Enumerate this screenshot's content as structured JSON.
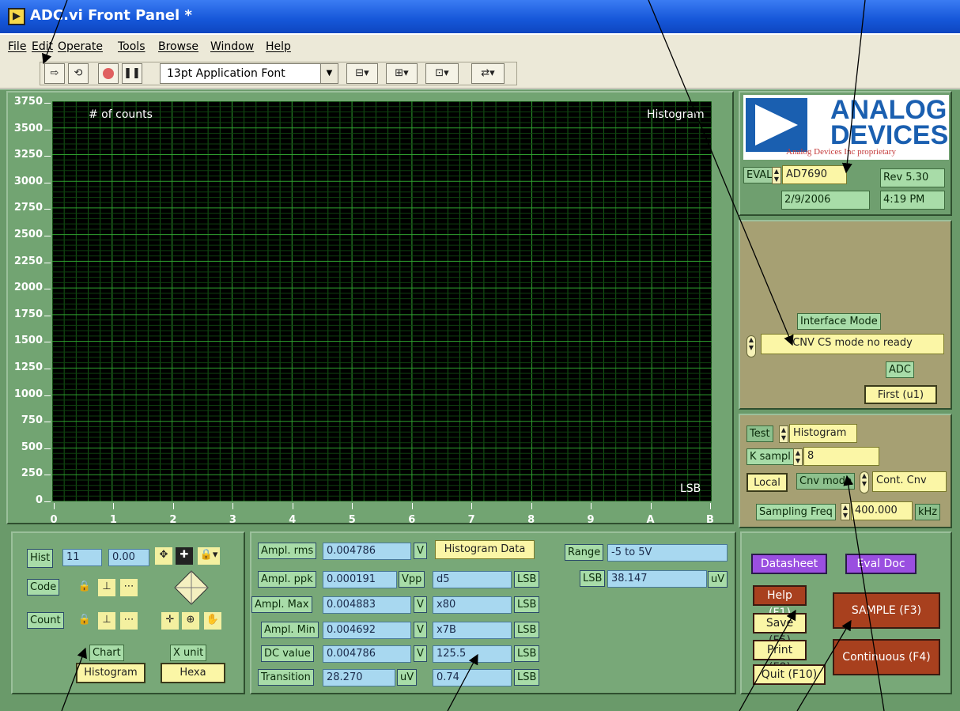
{
  "window": {
    "title": "ADC.vi Front Panel *"
  },
  "menu": [
    "File",
    "Edit",
    "Operate",
    "Tools",
    "Browse",
    "Window",
    "Help"
  ],
  "toolbar": {
    "font": "13pt Application Font"
  },
  "graph": {
    "y_ticks": [
      "3750",
      "3500",
      "3250",
      "3000",
      "2750",
      "2500",
      "2250",
      "2000",
      "1750",
      "1500",
      "1250",
      "1000",
      "750",
      "500",
      "250",
      "0"
    ],
    "x_ticks": [
      "0",
      "1",
      "2",
      "3",
      "4",
      "5",
      "6",
      "7",
      "8",
      "9",
      "A",
      "B"
    ],
    "ylabel": "# of counts",
    "title": "Histogram",
    "xlabel": "LSB"
  },
  "logo": {
    "line1": "ANALOG",
    "line2": "DEVICES",
    "proprietary": "Analog Devices Inc proprietary"
  },
  "info": {
    "eval_label": "EVAL-",
    "model": "AD7690",
    "rev": "Rev 5.30",
    "date": "2/9/2006",
    "time": "4:19 PM"
  },
  "interface": {
    "label": "Interface Mode",
    "value": "CNV CS mode no ready",
    "adc_label": "ADC",
    "adc_value": "First (u1)"
  },
  "test": {
    "test_label": "Test",
    "test_value": "Histogram",
    "ksampl_label": "K sampl",
    "ksampl_value": "8",
    "local": "Local",
    "cnv_mode_label": "Cnv mode",
    "cnv_mode_value": "Cont. Cnv",
    "freq_label": "Sampling Freq",
    "freq_value": "400.000",
    "freq_unit": "kHz"
  },
  "cursor": {
    "hist_label": "Hist",
    "hist_a": "11",
    "hist_b": "0.00",
    "code_label": "Code",
    "count_label": "Count",
    "chart_label": "Chart",
    "chart_value": "Histogram",
    "xunit_label": "X unit",
    "xunit_value": "Hexa"
  },
  "measurements": {
    "rows": [
      {
        "label": "Ampl. rms",
        "value": "0.004786",
        "unit": "V"
      },
      {
        "label": "Ampl. ppk",
        "value": "0.000191",
        "unit": "Vpp"
      },
      {
        "label": "Ampl. Max",
        "value": "0.004883",
        "unit": "V"
      },
      {
        "label": "Ampl. Min",
        "value": "0.004692",
        "unit": "V"
      },
      {
        "label": "DC value",
        "value": "0.004786",
        "unit": "V"
      },
      {
        "label": "Transition",
        "value": "28.270",
        "unit": "uV"
      }
    ],
    "hist_data_label": "Histogram Data",
    "hist_values": [
      "d5",
      "x80",
      "x7B",
      "125.5",
      "0.74"
    ],
    "lsb_unit": "LSB",
    "range_label": "Range",
    "range_value": "-5 to 5V",
    "lsb_label": "LSB",
    "lsb_value": "38.147",
    "lsb_unit2": "uV"
  },
  "buttons": {
    "datasheet": "Datasheet",
    "eval_doc": "Eval Doc",
    "help": "Help (F1)",
    "save": "Save (F5)",
    "print": "Print (F8)",
    "quit": "Quit (F10)",
    "sample": "SAMPLE (F3)",
    "continuous": "Continuous (F4)"
  },
  "colors": {
    "panel": "#6a9a6a",
    "plot_bg": "#000000",
    "grid": "#2f8a2f",
    "button_red": "#a8401e",
    "button_purple": "#9a4fe0"
  }
}
